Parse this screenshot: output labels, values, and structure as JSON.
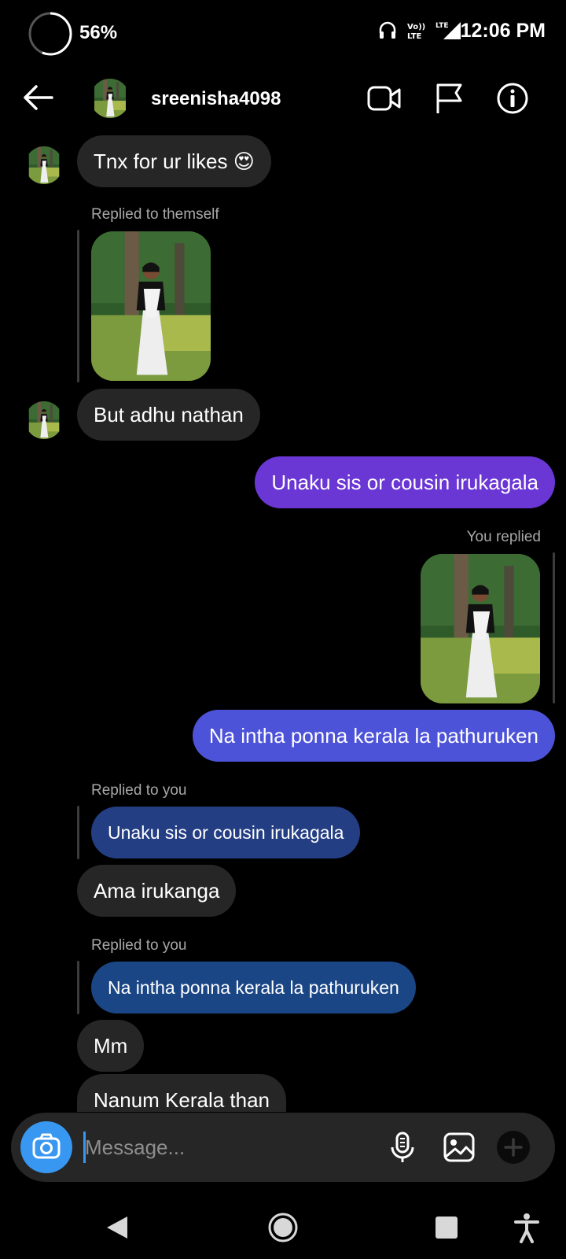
{
  "status": {
    "battery": "56%",
    "time": "12:06 PM",
    "net_top": "Vo))",
    "net_bottom": "LTE",
    "lte": "LTE"
  },
  "header": {
    "username": "sreenisha4098"
  },
  "messages": {
    "m1": "Tnx for ur likes 😍",
    "reply1_meta": "Replied to themself",
    "m2": "But adhu nathan",
    "m3": "Unaku sis or cousin irukagala",
    "you_replied": "You replied",
    "m4": "Na intha ponna kerala la pathuruken",
    "reply2_meta": "Replied to you",
    "quote1": "Unaku sis or cousin irukagala",
    "m5": "Ama irukanga",
    "reply3_meta": "Replied to you",
    "quote2": "Na intha ponna kerala la pathuruken",
    "m6": "Mm",
    "m7": "Nanum Kerala than"
  },
  "composer": {
    "placeholder": "Message..."
  },
  "colors": {
    "accent": "#3897f0",
    "outgoing_purple": "#6a36d4",
    "outgoing_indigo": "#4d53d8",
    "incoming": "#262626"
  }
}
